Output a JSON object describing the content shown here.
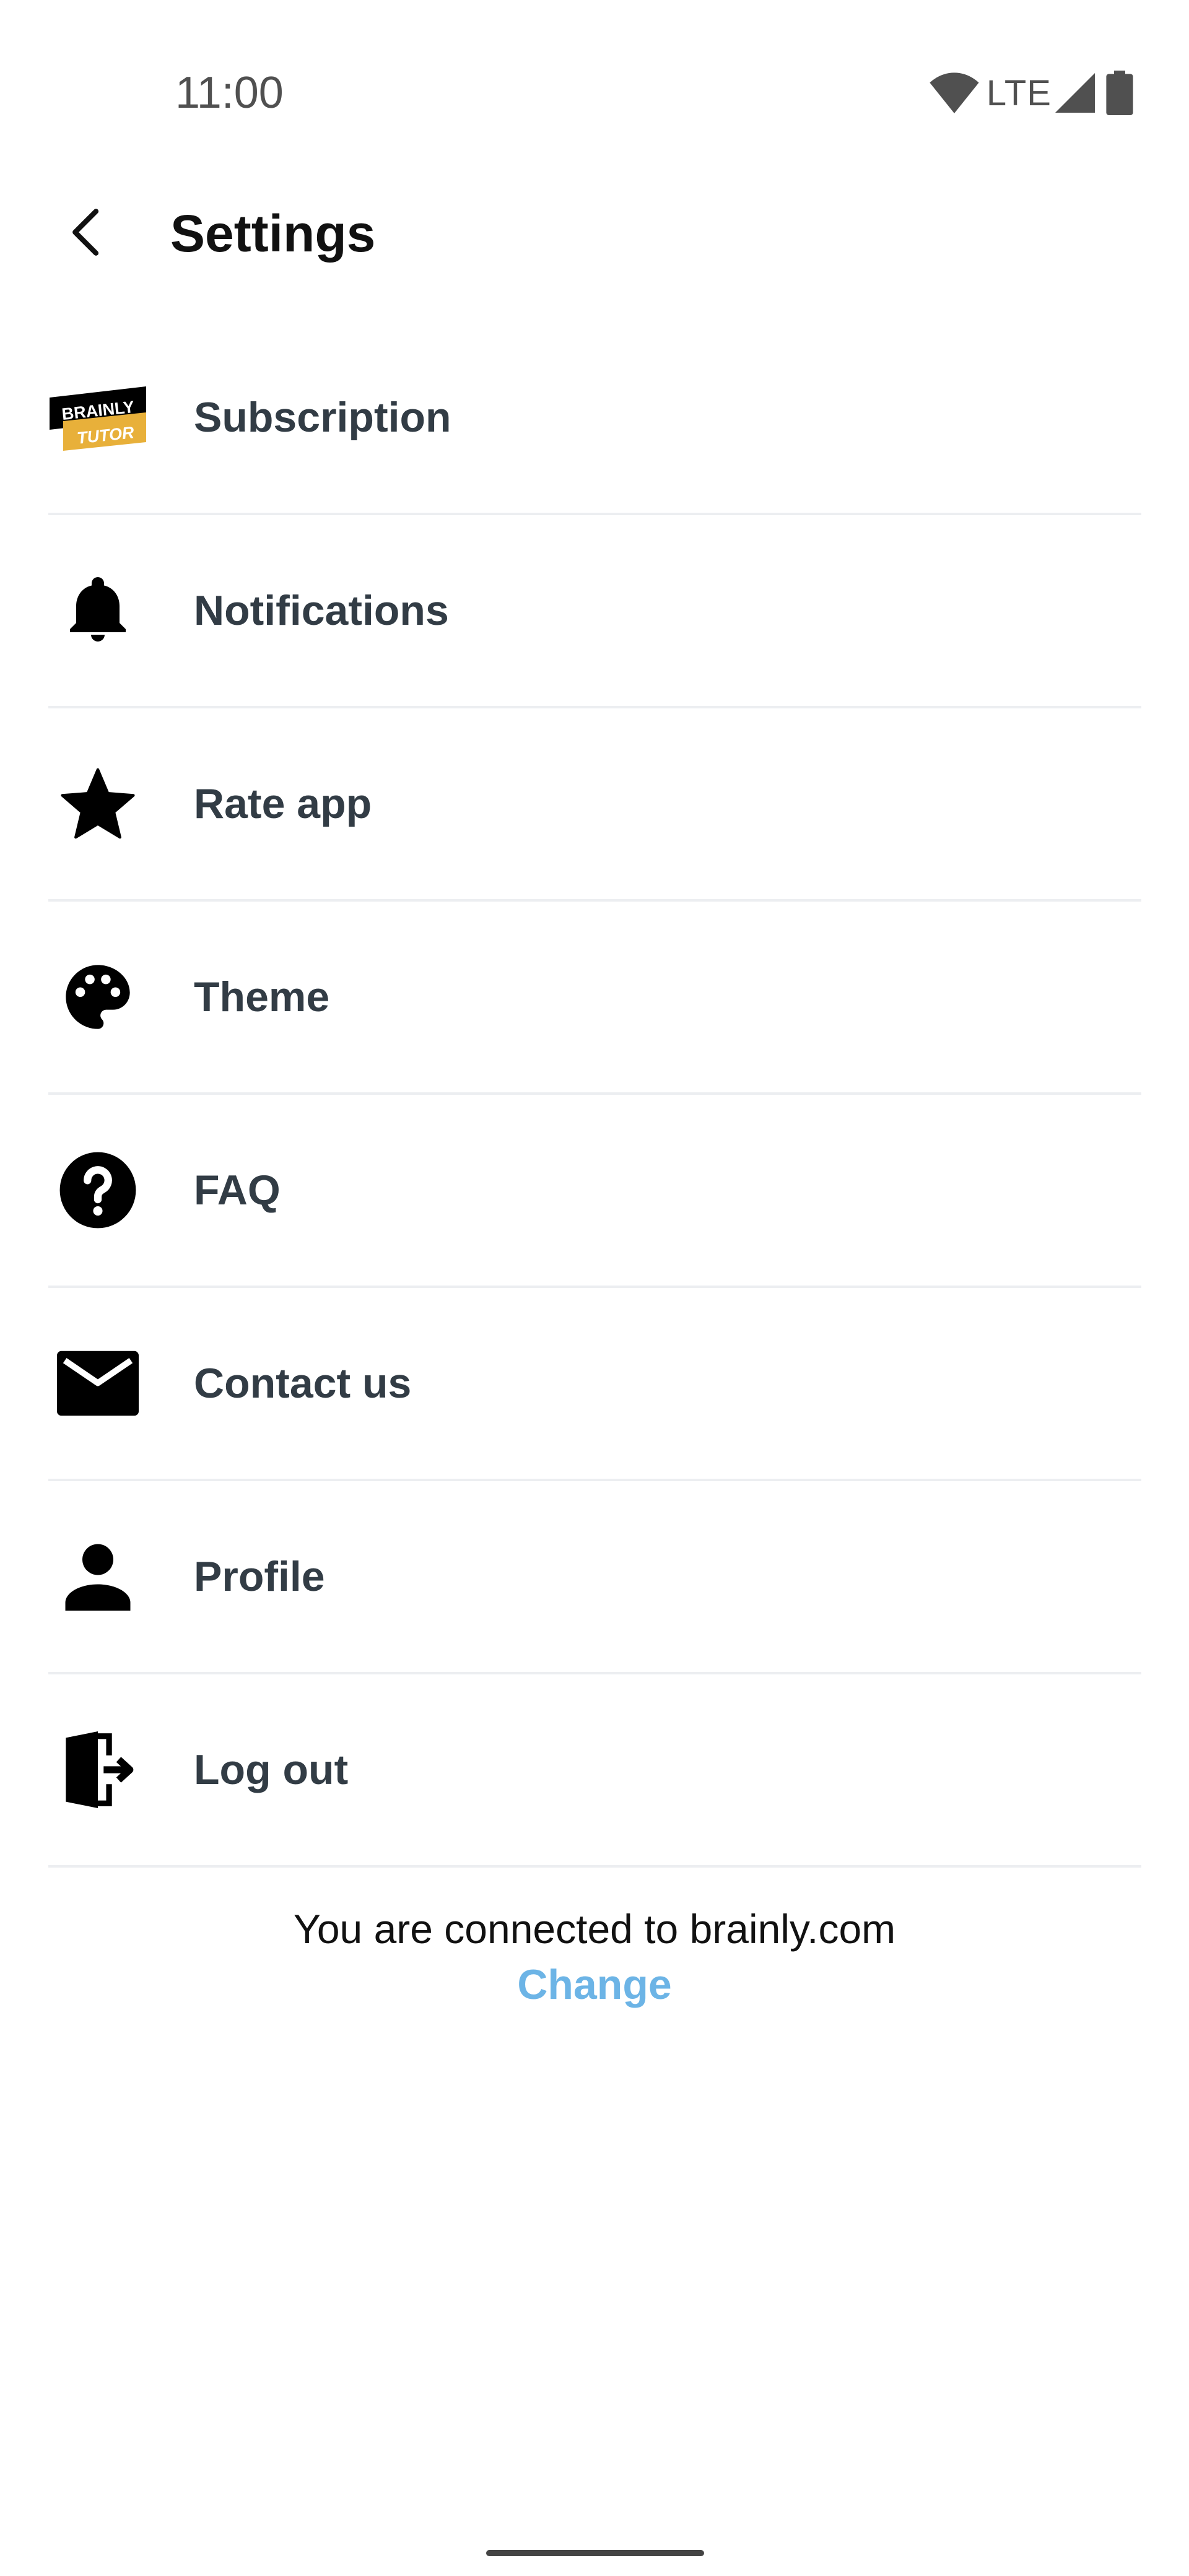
{
  "status_bar": {
    "time": "11:00",
    "network": "LTE",
    "icons": [
      "wifi-icon",
      "cell-signal-icon",
      "battery-icon"
    ]
  },
  "header": {
    "title": "Settings",
    "back_icon": "back-arrow-icon"
  },
  "settings": {
    "items": [
      {
        "label": "Subscription",
        "icon": "brainly-tutor-logo"
      },
      {
        "label": "Notifications",
        "icon": "bell-icon"
      },
      {
        "label": "Rate app",
        "icon": "star-icon"
      },
      {
        "label": "Theme",
        "icon": "palette-icon"
      },
      {
        "label": "FAQ",
        "icon": "help-icon"
      },
      {
        "label": "Contact us",
        "icon": "mail-icon"
      },
      {
        "label": "Profile",
        "icon": "person-icon"
      },
      {
        "label": "Log out",
        "icon": "logout-icon"
      }
    ]
  },
  "logo": {
    "line1": "BRAINLY",
    "line2": "TUTOR",
    "colors": {
      "dark": "#000000",
      "accent": "#e8b03a"
    }
  },
  "footer": {
    "connected_text": "You are connected to brainly.com",
    "change_label": "Change"
  },
  "colors": {
    "label": "#323c45",
    "link": "#6cb4e6",
    "divider": "#eceef1"
  }
}
